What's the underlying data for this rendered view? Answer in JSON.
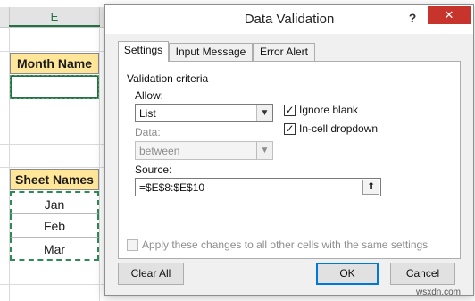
{
  "sheet": {
    "column_header": "E",
    "month_header": "Month Name",
    "sheet_header": "Sheet Names",
    "months": [
      "Jan",
      "Feb",
      "Mar"
    ],
    "accent_color": "#217346",
    "header_fill": "#ffe699"
  },
  "dialog": {
    "title": "Data Validation",
    "help_label": "?",
    "close_label": "✕",
    "tabs": [
      {
        "label": "Settings",
        "active": true
      },
      {
        "label": "Input Message",
        "active": false
      },
      {
        "label": "Error Alert",
        "active": false
      }
    ],
    "criteria_label": "Validation criteria",
    "allow_label": "Allow:",
    "allow_value": "List",
    "data_label": "Data:",
    "data_value": "between",
    "ignore_blank_label": "Ignore blank",
    "ignore_blank_checked": true,
    "dropdown_label": "In-cell dropdown",
    "dropdown_checked": true,
    "source_label": "Source:",
    "source_value": "=$E$8:$E$10",
    "source_button_icon": "collapse-dialog-icon",
    "apply_label": "Apply these changes to all other cells with the same settings",
    "apply_checked": false,
    "buttons": {
      "clear_all": "Clear All",
      "ok": "OK",
      "cancel": "Cancel"
    }
  },
  "watermark": "wsxdn.com"
}
